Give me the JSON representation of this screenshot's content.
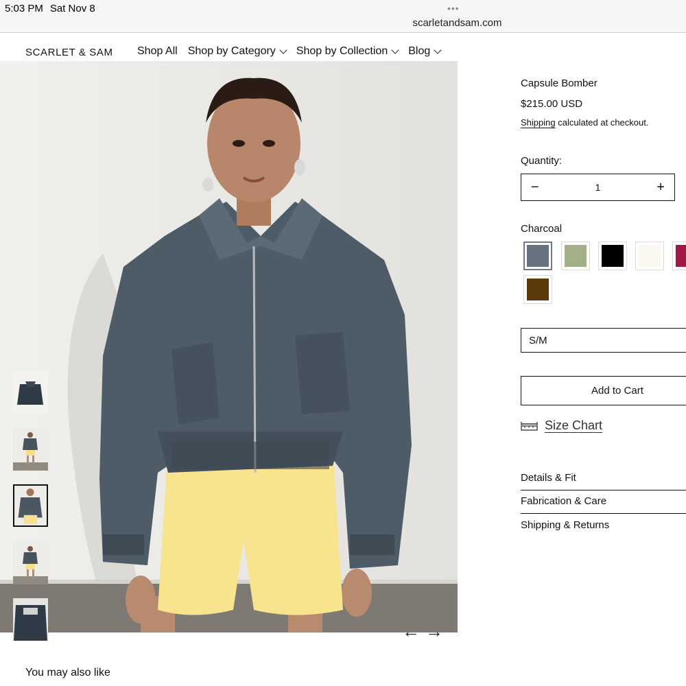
{
  "status": {
    "time": "5:03 PM",
    "date": "Sat Nov 8",
    "url": "scarletandsam.com",
    "dots": "•••"
  },
  "header": {
    "logo": "SCARLET & SAM",
    "nav": [
      {
        "label": "Shop All",
        "dropdown": false
      },
      {
        "label": "Shop by Category",
        "dropdown": true
      },
      {
        "label": "Shop by Collection",
        "dropdown": true
      },
      {
        "label": "Blog",
        "dropdown": true
      }
    ]
  },
  "gallery": {
    "thumbnail_count": 5,
    "active_thumbnail": 3,
    "prev_arrow": "←",
    "next_arrow": "→"
  },
  "product": {
    "title": "Capsule Bomber",
    "price": "$215.00 USD",
    "shipping_link": "Shipping",
    "shipping_rest": " calculated at checkout.",
    "quantity_label": "Quantity:",
    "quantity": "1",
    "minus": "−",
    "plus": "+",
    "color_label": "Charcoal",
    "swatches": [
      {
        "name": "Charcoal",
        "color": "#66737e",
        "selected": true
      },
      {
        "name": "Sage",
        "color": "#a3af86",
        "selected": false
      },
      {
        "name": "Black",
        "color": "#000000",
        "selected": false
      },
      {
        "name": "Cream",
        "color": "#fbf9ef",
        "selected": false
      },
      {
        "name": "Berry",
        "color": "#a3164a",
        "selected": false
      },
      {
        "name": "Brown",
        "color": "#5b3a0b",
        "selected": false
      }
    ],
    "size_value": "S/M",
    "add_to_cart": "Add to Cart",
    "size_chart": "Size Chart",
    "accordions": [
      "Details & Fit",
      "Fabrication & Care",
      "Shipping & Returns"
    ]
  },
  "recommendations": {
    "heading": "You may also like"
  }
}
